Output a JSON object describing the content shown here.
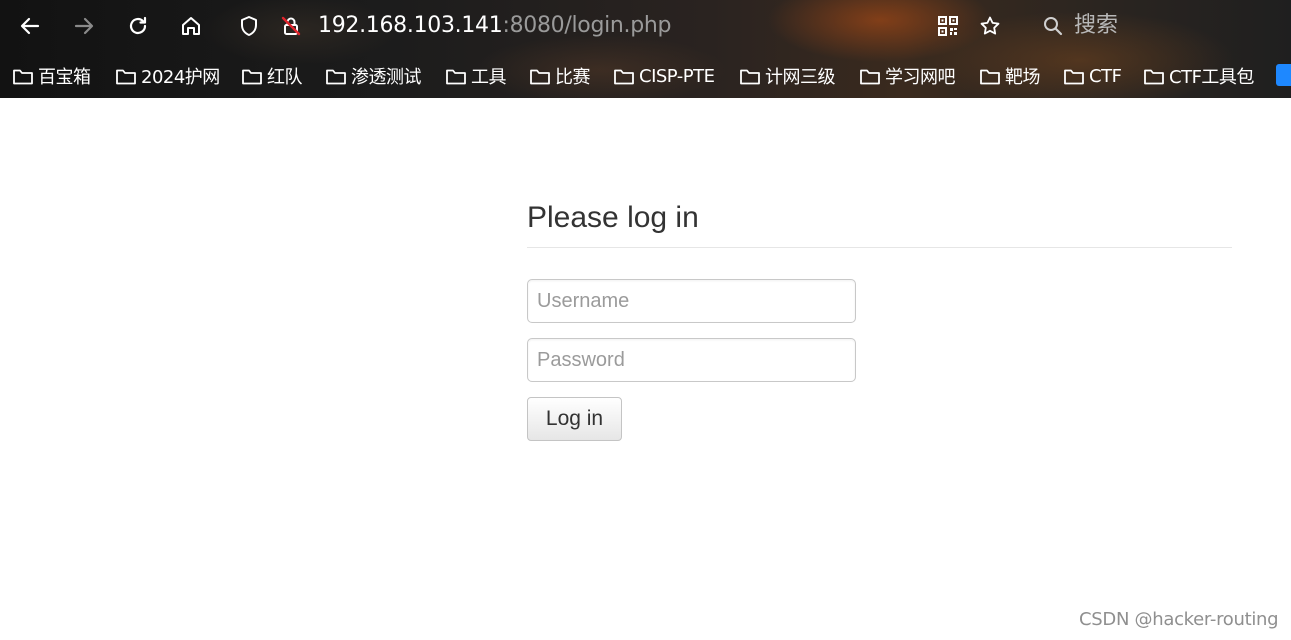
{
  "browser": {
    "address": {
      "host": "192.168.103.141",
      "rest": ":8080/login.php"
    },
    "search_label": "搜索",
    "bookmarks": [
      {
        "label": "百宝箱"
      },
      {
        "label": "2024护网"
      },
      {
        "label": "红队"
      },
      {
        "label": "渗透测试"
      },
      {
        "label": "工具"
      },
      {
        "label": "比赛"
      },
      {
        "label": "CISP-PTE"
      },
      {
        "label": "计网三级"
      },
      {
        "label": "学习网吧"
      },
      {
        "label": "靶场"
      },
      {
        "label": "CTF"
      },
      {
        "label": "CTF工具包"
      }
    ]
  },
  "login": {
    "heading": "Please log in",
    "username_placeholder": "Username",
    "password_placeholder": "Password",
    "submit_label": "Log in"
  },
  "watermark": "CSDN @hacker-routing",
  "colors": {
    "heading": "#333333",
    "divider": "#e6e6e6",
    "placeholder": "#9b9b9b"
  }
}
